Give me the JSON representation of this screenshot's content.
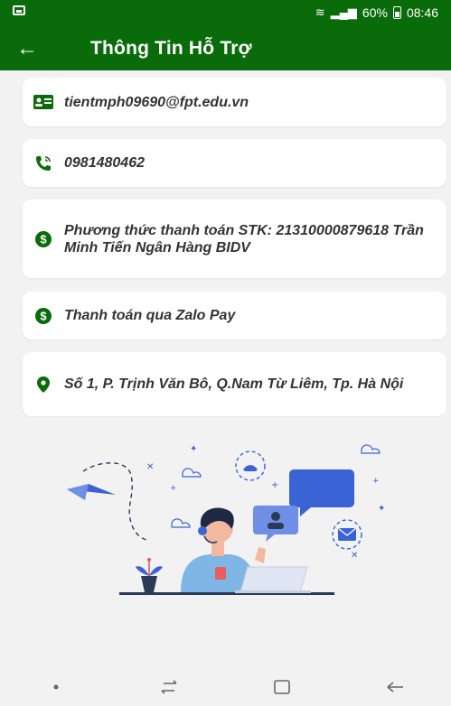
{
  "status_bar": {
    "battery": "60%",
    "time": "08:46"
  },
  "app_bar": {
    "title": "Thông Tin Hỗ Trợ"
  },
  "contacts": [
    {
      "icon": "id-card-icon",
      "text": "tientmph09690@fpt.edu.vn"
    },
    {
      "icon": "phone-icon",
      "text": "0981480462"
    },
    {
      "icon": "dollar-icon",
      "text": "Phương thức thanh toán STK: 21310000879618 Trần Minh Tiến Ngân Hàng BIDV"
    },
    {
      "icon": "dollar-icon",
      "text": "Thanh toán qua Zalo Pay"
    },
    {
      "icon": "location-pin-icon",
      "text": "Số 1, P. Trịnh Văn Bô, Q.Nam Từ Liêm, Tp. Hà Nội"
    }
  ],
  "colors": {
    "primary": "#0a6b0a",
    "background": "#f2f2f2",
    "card": "#ffffff",
    "accent_blue": "#3a63d6"
  }
}
